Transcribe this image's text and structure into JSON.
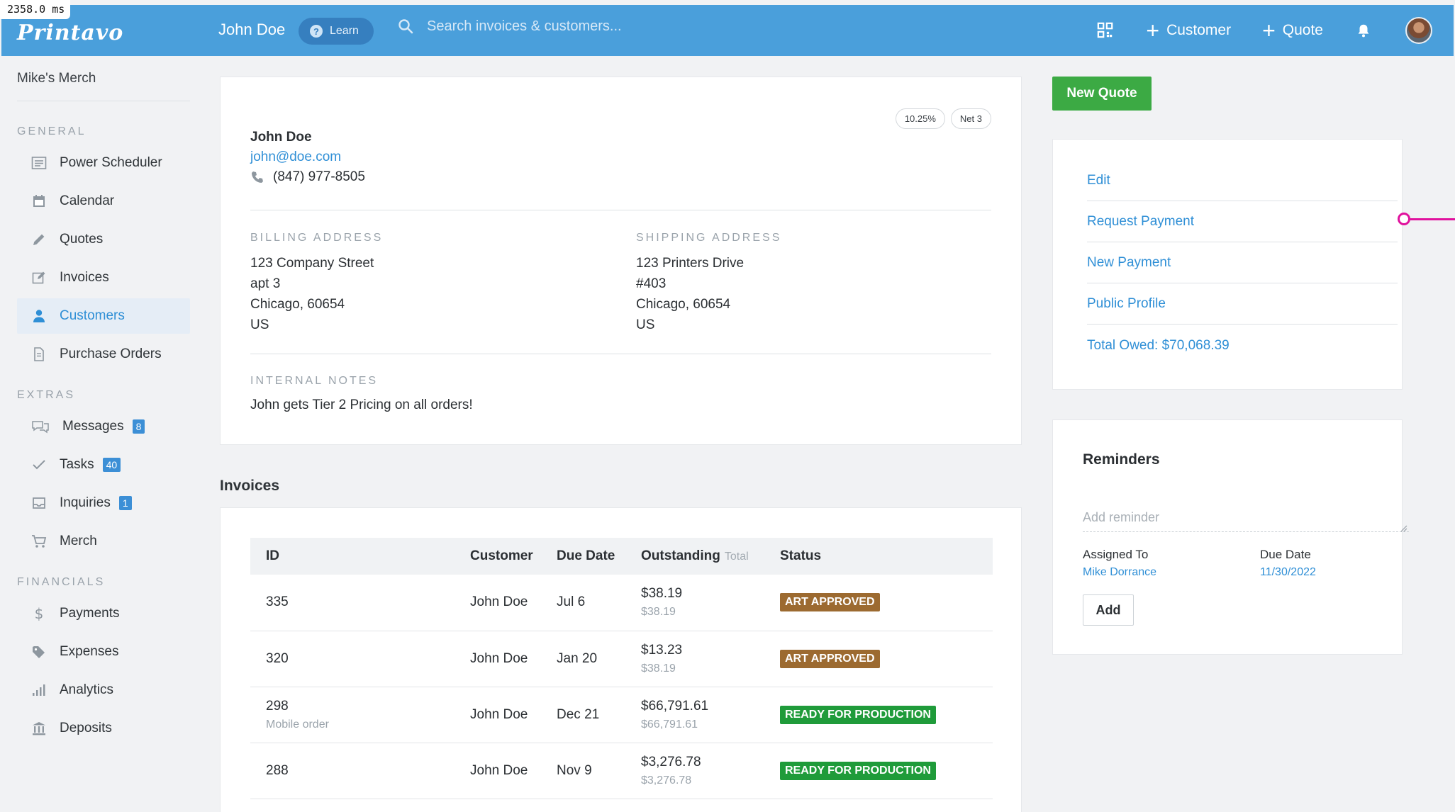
{
  "debug": {
    "timing": "2358.0 ms"
  },
  "topbar": {
    "logo": "Printavo",
    "user": "John Doe",
    "learn_label": "Learn",
    "search_placeholder": "Search invoices & customers...",
    "add_customer_label": "Customer",
    "add_quote_label": "Quote",
    "accent": "#4a9fdb"
  },
  "sidebar": {
    "org": "Mike's Merch",
    "general_heading": "GENERAL",
    "general": [
      {
        "label": "Power Scheduler",
        "icon": "schedule-icon"
      },
      {
        "label": "Calendar",
        "icon": "calendar-icon"
      },
      {
        "label": "Quotes",
        "icon": "pencil-icon"
      },
      {
        "label": "Invoices",
        "icon": "edit-icon"
      },
      {
        "label": "Customers",
        "icon": "user-icon",
        "active": true
      },
      {
        "label": "Purchase Orders",
        "icon": "document-icon"
      }
    ],
    "extras_heading": "EXTRAS",
    "extras": [
      {
        "label": "Messages",
        "icon": "chat-icon",
        "badge": "8"
      },
      {
        "label": "Tasks",
        "icon": "check-icon",
        "badge": "40"
      },
      {
        "label": "Inquiries",
        "icon": "inbox-icon",
        "badge": "1"
      },
      {
        "label": "Merch",
        "icon": "cart-icon"
      }
    ],
    "financials_heading": "FINANCIALS",
    "financials": [
      {
        "label": "Payments",
        "icon": "dollar-icon"
      },
      {
        "label": "Expenses",
        "icon": "tag-icon"
      },
      {
        "label": "Analytics",
        "icon": "bar-chart-icon"
      },
      {
        "label": "Deposits",
        "icon": "bank-icon"
      }
    ]
  },
  "customer": {
    "tax_pill": "10.25%",
    "terms_pill": "Net 3",
    "name": "John Doe",
    "email": "john@doe.com",
    "phone": "(847) 977-8505",
    "billing_label": "BILLING ADDRESS",
    "billing": [
      "123 Company Street",
      "apt 3",
      "Chicago, 60654",
      "US"
    ],
    "shipping_label": "SHIPPING ADDRESS",
    "shipping": [
      "123 Printers Drive",
      "#403",
      "Chicago, 60654",
      "US"
    ],
    "notes_label": "INTERNAL NOTES",
    "notes": "John gets Tier 2 Pricing on all orders!"
  },
  "invoices": {
    "title": "Invoices",
    "columns": {
      "id": "ID",
      "customer": "Customer",
      "due": "Due Date",
      "outstanding": "Outstanding",
      "outstanding_sub": "Total",
      "status": "Status"
    },
    "rows": [
      {
        "id": "335",
        "sub": "",
        "customer": "John Doe",
        "due": "Jul 6",
        "outstanding": "$38.19",
        "total": "$38.19",
        "status": "ART APPROVED",
        "kind": "art"
      },
      {
        "id": "320",
        "sub": "",
        "customer": "John Doe",
        "due": "Jan 20",
        "outstanding": "$13.23",
        "total": "$38.19",
        "status": "ART APPROVED",
        "kind": "art"
      },
      {
        "id": "298",
        "sub": "Mobile order",
        "customer": "John Doe",
        "due": "Dec 21",
        "outstanding": "$66,791.61",
        "total": "$66,791.61",
        "status": "READY FOR PRODUCTION",
        "kind": "ready"
      },
      {
        "id": "288",
        "sub": "",
        "customer": "John Doe",
        "due": "Nov 9",
        "outstanding": "$3,276.78",
        "total": "$3,276.78",
        "status": "READY FOR PRODUCTION",
        "kind": "ready"
      }
    ],
    "status_colors": {
      "art": "#9c6a30",
      "ready": "#1f9b3a"
    }
  },
  "actions": {
    "new_quote": "New Quote",
    "links": [
      "Edit",
      "Request Payment",
      "New Payment",
      "Public Profile",
      "Total Owed: $70,068.39"
    ]
  },
  "reminders": {
    "title": "Reminders",
    "placeholder": "Add reminder",
    "assigned_label": "Assigned To",
    "assigned_value": "Mike Dorrance",
    "due_label": "Due Date",
    "due_value": "11/30/2022",
    "add_label": "Add"
  }
}
